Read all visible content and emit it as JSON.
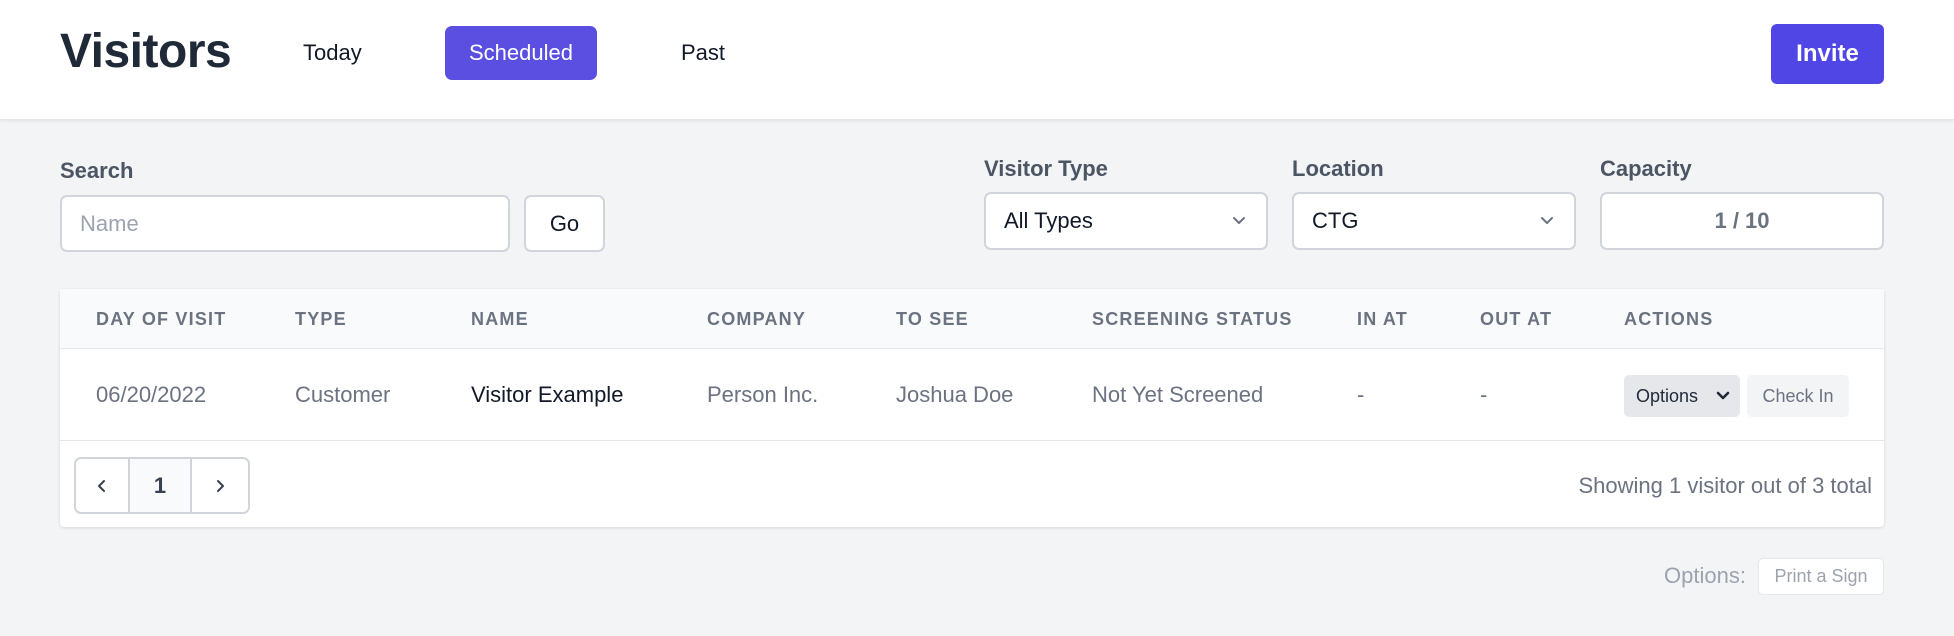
{
  "header": {
    "title": "Visitors",
    "tabs": [
      {
        "label": "Today",
        "active": false
      },
      {
        "label": "Scheduled",
        "active": true
      },
      {
        "label": "Past",
        "active": false
      }
    ],
    "invite_label": "Invite"
  },
  "filters": {
    "search_label": "Search",
    "search_placeholder": "Name",
    "search_value": "",
    "go_label": "Go",
    "visitor_type_label": "Visitor Type",
    "visitor_type_value": "All Types",
    "location_label": "Location",
    "location_value": "CTG",
    "capacity_label": "Capacity",
    "capacity_value": "1 / 10"
  },
  "table": {
    "columns": [
      "DAY OF VISIT",
      "TYPE",
      "NAME",
      "COMPANY",
      "TO SEE",
      "SCREENING STATUS",
      "IN AT",
      "OUT AT",
      "ACTIONS"
    ],
    "rows": [
      {
        "day": "06/20/2022",
        "type": "Customer",
        "name": "Visitor Example",
        "company": "Person Inc.",
        "to_see": "Joshua Doe",
        "screening": "Not Yet Screened",
        "in_at": "-",
        "out_at": "-",
        "options_label": "Options",
        "checkin_label": "Check In"
      }
    ],
    "pagination": {
      "current_page": "1"
    },
    "showing_text": "Showing 1 visitor out of 3 total"
  },
  "footer": {
    "options_label": "Options:",
    "print_label": "Print a Sign"
  },
  "colors": {
    "accent": "#4f46e5",
    "tab_active": "#5a4fe0",
    "background": "#f3f4f6"
  },
  "icons": [
    "chevron-down-icon",
    "chevron-left-icon",
    "chevron-right-icon"
  ]
}
